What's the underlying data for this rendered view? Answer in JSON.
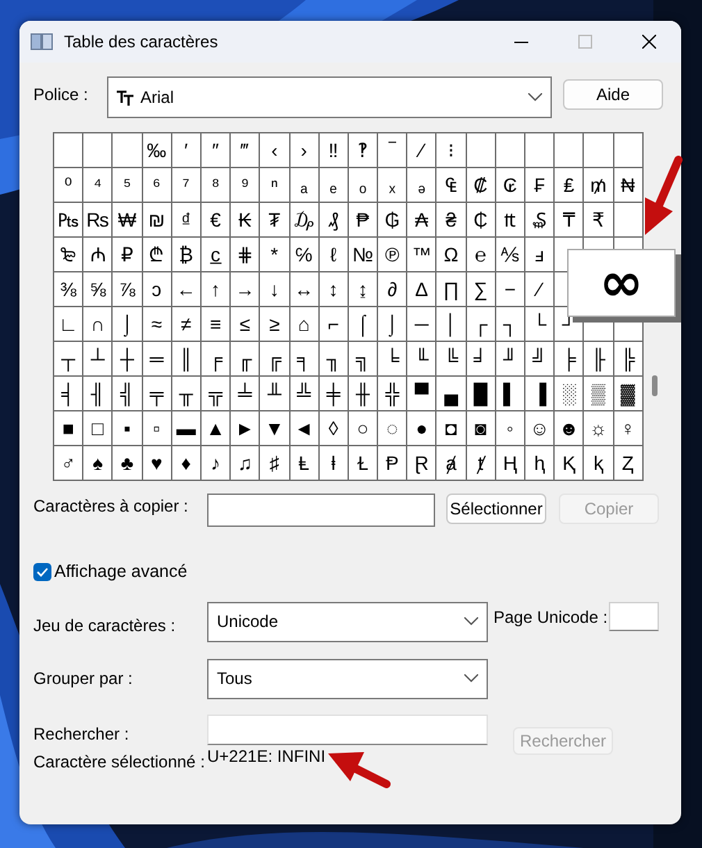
{
  "window": {
    "title": "Table des caractères"
  },
  "font": {
    "label": "Police :",
    "value": "Arial"
  },
  "help_button": "Aide",
  "grid": {
    "rows": [
      [
        null,
        null,
        null,
        "‰",
        "′",
        "″",
        "‴",
        "‹",
        "›",
        "‼",
        "‽",
        "‾",
        "⁄",
        "⁝",
        null,
        null,
        null,
        null,
        null,
        null
      ],
      [
        "⁰",
        "⁴",
        "⁵",
        "⁶",
        "⁷",
        "⁸",
        "⁹",
        "ⁿ",
        "ₐ",
        "ₑ",
        "ₒ",
        "ₓ",
        "ₔ",
        "₠",
        "₡",
        "₢",
        "₣",
        "₤",
        "₥",
        "₦"
      ],
      [
        "₧",
        "₨",
        "₩",
        "₪",
        "₫",
        "€",
        "₭",
        "₮",
        "₯",
        "₰",
        "₱",
        "₲",
        "₳",
        "₴",
        "₵",
        "₶",
        "₷",
        "₸",
        "₹",
        null
      ],
      [
        "₻",
        "₼",
        "₽",
        "₾",
        "₿",
        "c̲",
        "⋕",
        "*",
        "℅",
        "ℓ",
        "№",
        "℗",
        "™",
        "Ω",
        "℮",
        "⅍",
        "ⅎ",
        null,
        null,
        null
      ],
      [
        "⅜",
        "⅝",
        "⅞",
        "ↄ",
        "←",
        "↑",
        "→",
        "↓",
        "↔",
        "↕",
        "↨",
        "∂",
        "∆",
        "∏",
        "∑",
        "−",
        "∕",
        null
      ],
      [
        "∟",
        "∩",
        "⌡",
        "≈",
        "≠",
        "≡",
        "≤",
        "≥",
        "⌂",
        "⌐",
        "⌠",
        "⌡",
        "─",
        "│",
        "┌",
        "┐",
        "└",
        "┘",
        null,
        null
      ],
      [
        "┬",
        "┴",
        "┼",
        "═",
        "║",
        "╒",
        "╓",
        "╔",
        "╕",
        "╖",
        "╗",
        "╘",
        "╙",
        "╚",
        "╛",
        "╜",
        "╝",
        "╞",
        "╟",
        "╠"
      ],
      [
        "╡",
        "╢",
        "╣",
        "╤",
        "╥",
        "╦",
        "╧",
        "╨",
        "╩",
        "╪",
        "╫",
        "╬",
        "▀",
        "▄",
        "█",
        "▌",
        "▐",
        "░",
        "▒",
        "▓"
      ],
      [
        "■",
        "□",
        "▪",
        "▫",
        "▬",
        "▲",
        "►",
        "▼",
        "◄",
        "◊",
        "○",
        "◌",
        "●",
        "◘",
        "◙",
        "◦",
        "☺",
        "☻",
        "☼",
        "♀"
      ],
      [
        "♂",
        "♠",
        "♣",
        "♥",
        "♦",
        "♪",
        "♫",
        "♯",
        "Ⱡ",
        "ⱡ",
        "Ɫ",
        "Ᵽ",
        "Ɽ",
        "ⱥ",
        "ⱦ",
        "Ⱨ",
        "ⱨ",
        "Ⱪ",
        "ⱪ",
        "Ⱬ"
      ]
    ]
  },
  "magnified": "∞",
  "copy": {
    "label": "Caractères à copier :",
    "select_button": "Sélectionner",
    "copy_button": {
      "label": "Copier",
      "disabled": true
    }
  },
  "advanced": {
    "label": "Affichage avancé",
    "checked": true
  },
  "charset": {
    "label": "Jeu de caractères :",
    "value": "Unicode"
  },
  "unicode_page": {
    "label": "Page Unicode :"
  },
  "group_by": {
    "label": "Grouper par :",
    "value": "Tous"
  },
  "search": {
    "label": "Rechercher :",
    "button": {
      "label": "Rechercher",
      "disabled": true
    }
  },
  "selected_char": {
    "label": "Caractère sélectionné :",
    "value": "U+221E: INFINI"
  }
}
